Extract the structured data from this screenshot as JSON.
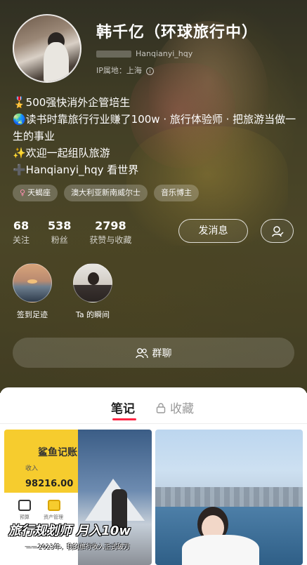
{
  "profile": {
    "name": "韩千亿（环球旅行中）",
    "id_label": "Hanqianyi_hqy",
    "ip_location": "IP属地：上海",
    "bio": [
      "🎖️500强快消外企管培生",
      "🌏读书时靠旅行行业赚了100w · 旅行体验师 · 把旅游当做一生的事业",
      "✨欢迎一起组队旅游",
      "➕Hanqianyi_hqy 看世界"
    ],
    "tags": [
      {
        "icon": "female-icon",
        "label": "天蝎座"
      },
      {
        "icon": "",
        "label": "澳大利亚新南威尔士"
      },
      {
        "icon": "",
        "label": "音乐博主"
      }
    ],
    "stats": [
      {
        "value": "68",
        "label": "关注"
      },
      {
        "value": "538",
        "label": "粉丝"
      },
      {
        "value": "2798",
        "label": "获赞与收藏"
      }
    ],
    "send_message_label": "发消息",
    "collections": [
      {
        "label": "签到足迹"
      },
      {
        "label": "Ta 的瞬间"
      }
    ],
    "group_chat_label": "群聊"
  },
  "tabs": {
    "notes_label": "笔记",
    "favorites_label": "收藏"
  },
  "feed": {
    "card_left": {
      "app_title": "鲨鱼记账",
      "income_label": "收入",
      "income_value": "98216.00",
      "app_icon_left_label": "预算",
      "app_icon_right_label": "资产管理",
      "overlay_title": "旅行规划师 月入10w",
      "overlay_subtitle": "——2023年，我的旅行收入正式破万"
    }
  },
  "colors": {
    "accent": "#ff2442",
    "header_bg": "#55502f",
    "app_yellow": "#f6cc2e"
  }
}
